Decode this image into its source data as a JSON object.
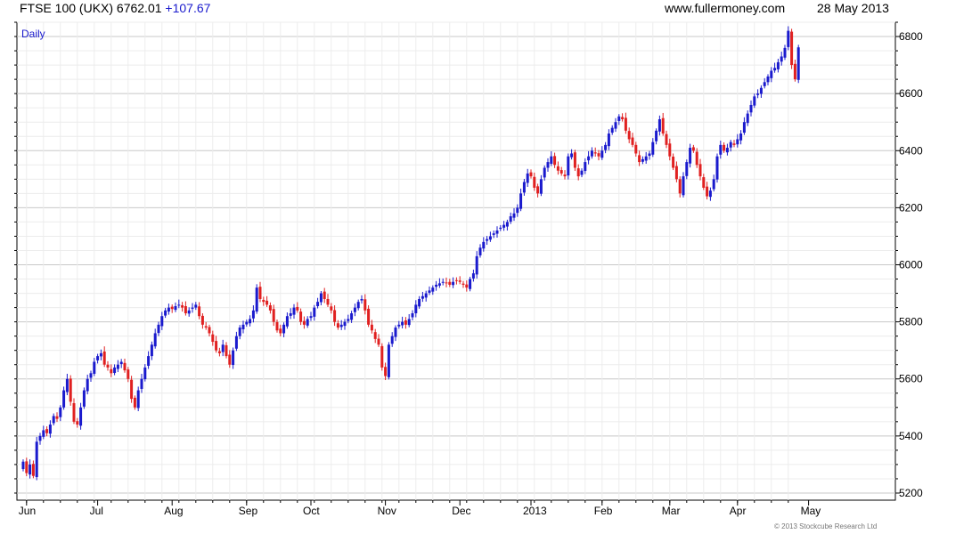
{
  "header": {
    "title": "FTSE 100 (UKX) 6762.01",
    "change": "+107.67",
    "website": "www.fullermoney.com",
    "date": "28 May 2013"
  },
  "footer": {
    "copyright": "© 2013 Stockcube Research Ltd"
  },
  "chart_data": {
    "type": "candlestick",
    "period_label": "Daily",
    "ylim": [
      5175,
      6850
    ],
    "yticks": [
      5200,
      5400,
      5600,
      5800,
      6000,
      6200,
      6400,
      6600,
      6800
    ],
    "xticks": [
      {
        "label": "Jun",
        "index": 1
      },
      {
        "label": "Jul",
        "index": 22
      },
      {
        "label": "Aug",
        "index": 44
      },
      {
        "label": "Sep",
        "index": 66
      },
      {
        "label": "Oct",
        "index": 85
      },
      {
        "label": "Nov",
        "index": 107
      },
      {
        "label": "Dec",
        "index": 129
      },
      {
        "label": "2013",
        "index": 150
      },
      {
        "label": "Feb",
        "index": 171
      },
      {
        "label": "Mar",
        "index": 191
      },
      {
        "label": "Apr",
        "index": 211
      },
      {
        "label": "May",
        "index": 232
      }
    ],
    "grid": true,
    "up_color": "#1a1acd",
    "down_color": "#e02020",
    "closes": [
      5310,
      5270,
      5300,
      5260,
      5380,
      5400,
      5420,
      5410,
      5440,
      5470,
      5460,
      5500,
      5560,
      5600,
      5520,
      5450,
      5440,
      5500,
      5560,
      5600,
      5620,
      5660,
      5680,
      5690,
      5650,
      5640,
      5620,
      5640,
      5650,
      5660,
      5630,
      5600,
      5530,
      5500,
      5560,
      5600,
      5640,
      5680,
      5720,
      5760,
      5790,
      5820,
      5840,
      5850,
      5845,
      5855,
      5860,
      5850,
      5830,
      5840,
      5850,
      5860,
      5820,
      5790,
      5780,
      5760,
      5730,
      5700,
      5690,
      5720,
      5680,
      5650,
      5700,
      5750,
      5780,
      5790,
      5800,
      5810,
      5840,
      5920,
      5880,
      5870,
      5860,
      5840,
      5800,
      5770,
      5760,
      5790,
      5820,
      5830,
      5850,
      5840,
      5800,
      5790,
      5810,
      5820,
      5850,
      5870,
      5900,
      5880,
      5860,
      5840,
      5800,
      5780,
      5790,
      5800,
      5810,
      5830,
      5850,
      5870,
      5880,
      5840,
      5790,
      5770,
      5740,
      5720,
      5640,
      5610,
      5720,
      5750,
      5780,
      5790,
      5800,
      5790,
      5810,
      5830,
      5860,
      5880,
      5890,
      5900,
      5910,
      5920,
      5930,
      5935,
      5940,
      5935,
      5930,
      5940,
      5945,
      5940,
      5930,
      5920,
      5950,
      5970,
      6030,
      6060,
      6080,
      6090,
      6100,
      6110,
      6120,
      6130,
      6140,
      6150,
      6170,
      6180,
      6200,
      6250,
      6290,
      6320,
      6310,
      6270,
      6250,
      6300,
      6340,
      6360,
      6380,
      6350,
      6330,
      6320,
      6310,
      6380,
      6390,
      6340,
      6310,
      6330,
      6360,
      6380,
      6400,
      6390,
      6380,
      6400,
      6420,
      6460,
      6480,
      6500,
      6520,
      6510,
      6470,
      6440,
      6420,
      6390,
      6360,
      6370,
      6380,
      6390,
      6430,
      6470,
      6510,
      6460,
      6420,
      6380,
      6340,
      6300,
      6250,
      6310,
      6360,
      6410,
      6400,
      6350,
      6310,
      6270,
      6240,
      6260,
      6300,
      6380,
      6420,
      6400,
      6410,
      6430,
      6420,
      6440,
      6460,
      6500,
      6530,
      6560,
      6590,
      6600,
      6620,
      6640,
      6660,
      6680,
      6690,
      6710,
      6730,
      6760,
      6820,
      6700,
      6650,
      6762.01
    ]
  }
}
